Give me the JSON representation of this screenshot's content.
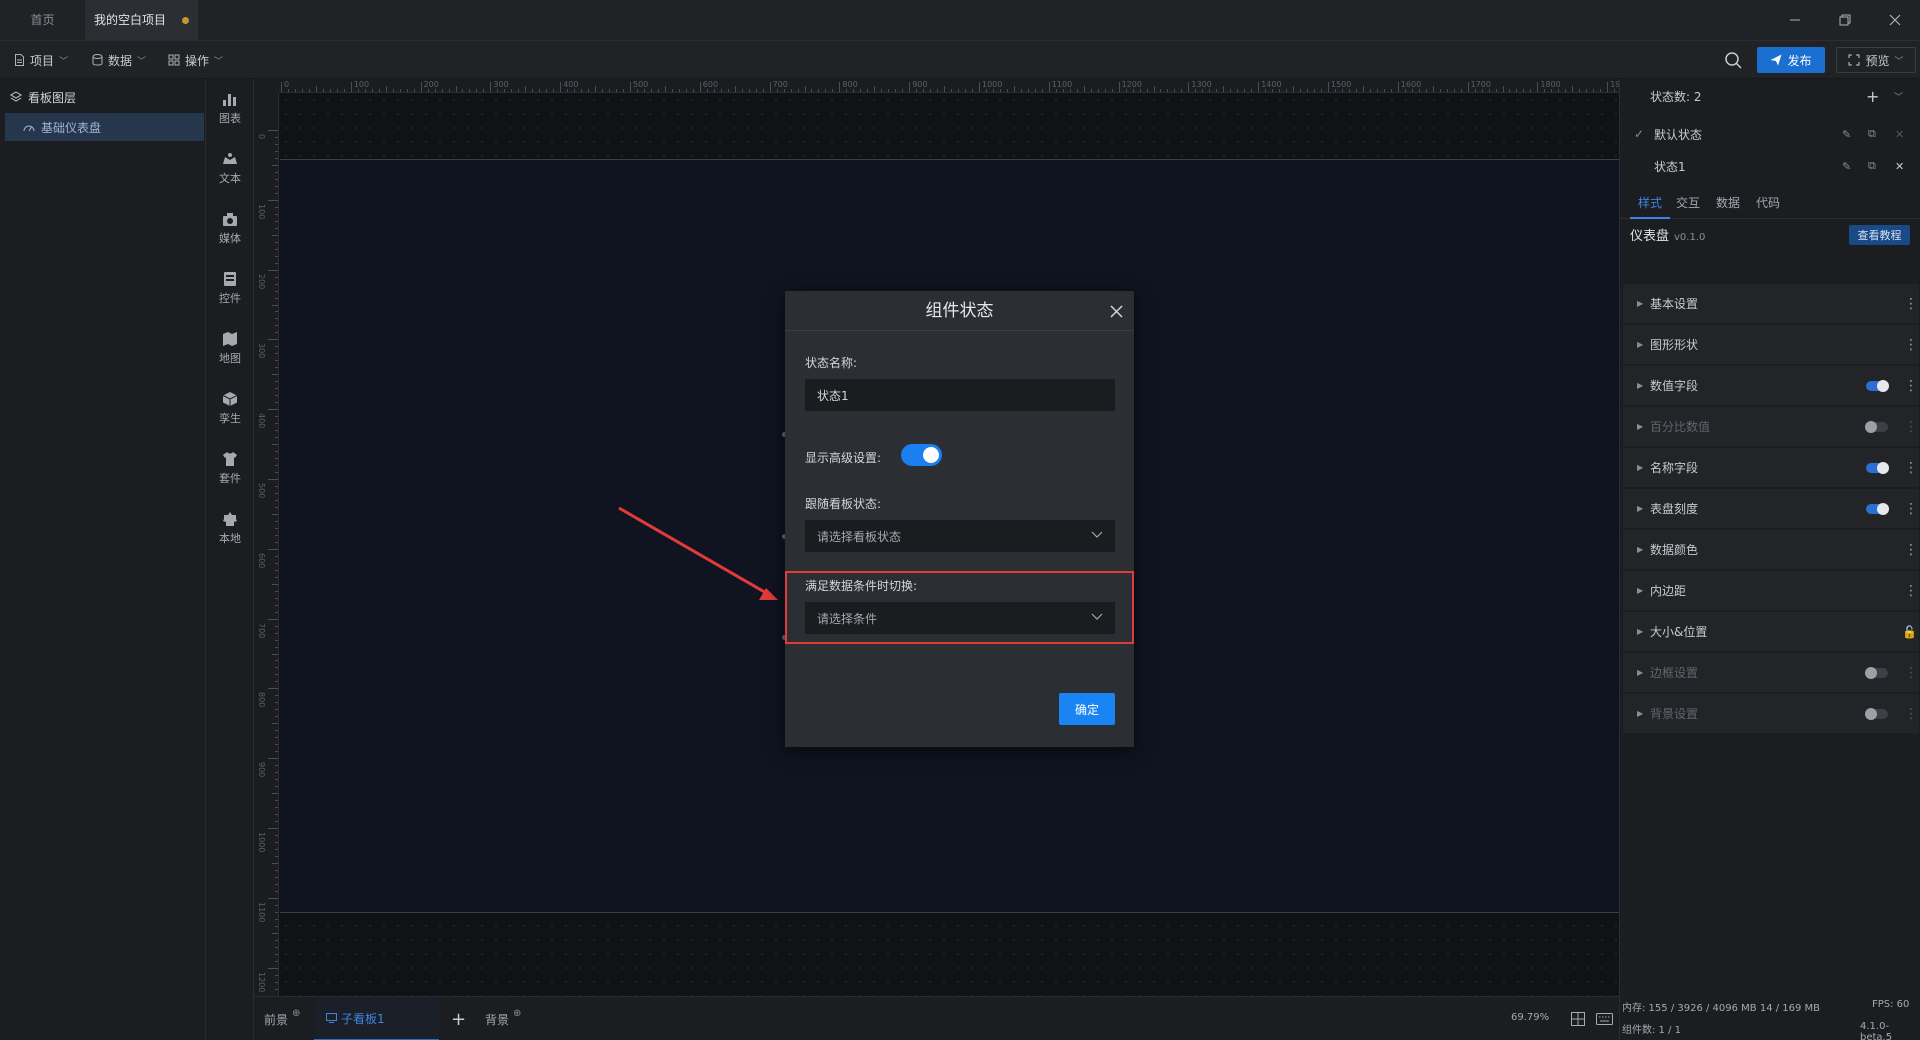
{
  "tabs": [
    {
      "label": "首页"
    },
    {
      "label": "我的空白项目",
      "unsaved": true
    }
  ],
  "menubar": {
    "items": [
      {
        "label": "项目",
        "icon": "file-icon"
      },
      {
        "label": "数据",
        "icon": "database-icon"
      },
      {
        "label": "操作",
        "icon": "grid-icon"
      }
    ],
    "publish_label": "发布",
    "preview_label": "预览"
  },
  "layers": {
    "title": "看板图层",
    "items": [
      {
        "label": "基础仪表盘"
      }
    ]
  },
  "tools": [
    {
      "label": "图表",
      "icon": "bar-chart-icon"
    },
    {
      "label": "文本",
      "icon": "text-icon"
    },
    {
      "label": "媒体",
      "icon": "media-icon"
    },
    {
      "label": "控件",
      "icon": "widget-icon"
    },
    {
      "label": "地图",
      "icon": "map-icon"
    },
    {
      "label": "孪生",
      "icon": "cube-icon"
    },
    {
      "label": "套件",
      "icon": "shirt-icon"
    },
    {
      "label": "本地",
      "icon": "local-icon"
    }
  ],
  "ruler": {
    "top_labels": [
      "0",
      "100",
      "200",
      "300",
      "400",
      "500",
      "600",
      "700",
      "800",
      "900",
      "1000",
      "1100",
      "1200",
      "1300",
      "1400",
      "1500",
      "1600",
      "1700",
      "1800",
      "1900"
    ],
    "left_labels": [
      "0",
      "100",
      "200",
      "300",
      "400",
      "500",
      "600",
      "700",
      "800",
      "900",
      "1000",
      "1100",
      "1200"
    ]
  },
  "bottombar": {
    "tabs": [
      {
        "label": "前景"
      },
      {
        "label": "子看板1",
        "active": true
      },
      {
        "label": "背景"
      }
    ],
    "zoom": "69.79%"
  },
  "rightpanel": {
    "state_count": "状态数: 2",
    "states": [
      {
        "label": "默认状态",
        "checked": true
      },
      {
        "label": "状态1",
        "checked": false
      }
    ],
    "tabs": [
      "样式",
      "交互",
      "数据",
      "代码"
    ],
    "component_name": "仪表盘",
    "component_version": "v0.1.0",
    "tutorial_label": "查看教程",
    "sections": [
      {
        "label": "基本设置",
        "control": "more",
        "enabled": true
      },
      {
        "label": "图形形状",
        "control": "more",
        "enabled": true
      },
      {
        "label": "数值字段",
        "control": "toggle-on",
        "enabled": true
      },
      {
        "label": "百分比数值",
        "control": "toggle-off",
        "enabled": false
      },
      {
        "label": "名称字段",
        "control": "toggle-on",
        "enabled": true
      },
      {
        "label": "表盘刻度",
        "control": "toggle-on",
        "enabled": true
      },
      {
        "label": "数据颜色",
        "control": "more",
        "enabled": true
      },
      {
        "label": "内边距",
        "control": "more",
        "enabled": true
      },
      {
        "label": "大小&位置",
        "control": "lock",
        "enabled": true
      },
      {
        "label": "边框设置",
        "control": "toggle-off",
        "enabled": false
      },
      {
        "label": "背景设置",
        "control": "toggle-off",
        "enabled": false
      }
    ]
  },
  "status": {
    "memory": "内存: 155 / 3926 / 4096 MB  14 / 169 MB",
    "components": "组件数: 1 / 1",
    "fps": "FPS:  60",
    "version": "4.1.0-beta.5"
  },
  "modal": {
    "title": "组件状态",
    "name_label": "状态名称:",
    "name_value": "状态1",
    "advanced_label": "显示高级设置:",
    "advanced_on": true,
    "follow_label": "跟随看板状态:",
    "follow_placeholder": "请选择看板状态",
    "condition_label": "满足数据条件时切换:",
    "condition_placeholder": "请选择条件",
    "confirm_label": "确定"
  },
  "colors": {
    "accent": "#1a84f5",
    "highlight": "#e23a3a",
    "stage_bg": "#0f1420"
  }
}
